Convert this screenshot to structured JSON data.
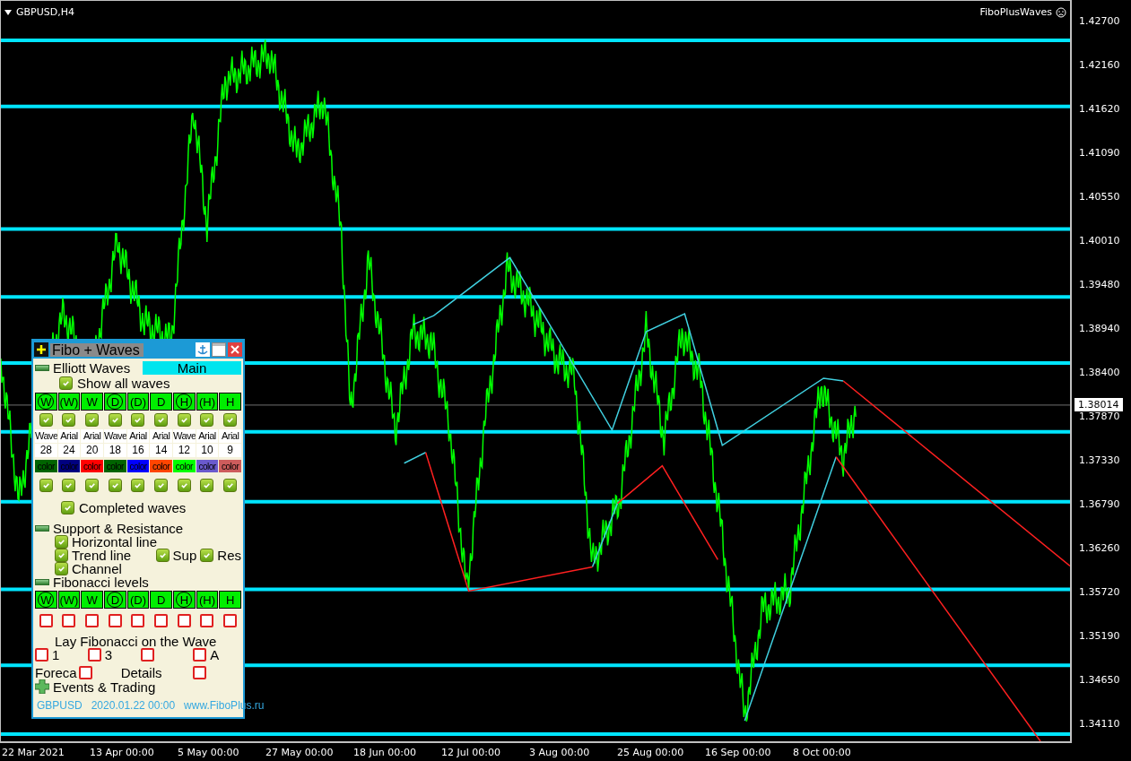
{
  "chart": {
    "symbol": "GBPUSD,H4",
    "indicator": "FiboPlusWaves",
    "price_labels": [
      "1.42700",
      "1.42160",
      "1.41620",
      "1.41090",
      "1.40550",
      "1.40010",
      "1.39480",
      "1.38940",
      "1.38400",
      "1.37870",
      "1.37330",
      "1.36790",
      "1.36260",
      "1.35720",
      "1.35190",
      "1.34650",
      "1.34110"
    ],
    "current_price": "1.38014",
    "time_labels": [
      "22 Mar 2021",
      "13 Apr 00:00",
      "5 May 00:00",
      "27 May 00:00",
      "18 Jun 00:00",
      "12 Jul 00:00",
      "3 Aug 00:00",
      "25 Aug 00:00",
      "16 Sep 00:00",
      "8 Oct 00:00"
    ]
  },
  "panel": {
    "title": "Fibo + Waves",
    "elliott": {
      "label": "Elliott Waves",
      "expanded": true,
      "main_button": "Main",
      "show_all": {
        "label": "Show all waves",
        "checked": true
      },
      "waves": [
        {
          "label": "W",
          "circled": true,
          "checked": true,
          "font": "Wave",
          "size": "28",
          "color": "#006400",
          "shown": true
        },
        {
          "label": "(W)",
          "circled": false,
          "checked": true,
          "font": "Arial",
          "size": "24",
          "color": "#000080",
          "shown": true
        },
        {
          "label": "W",
          "circled": false,
          "checked": true,
          "font": "Arial",
          "size": "20",
          "color": "#ff0000",
          "shown": true
        },
        {
          "label": "D",
          "circled": true,
          "checked": true,
          "font": "Wave",
          "size": "18",
          "color": "#006400",
          "shown": true
        },
        {
          "label": "(D)",
          "circled": false,
          "checked": true,
          "font": "Arial",
          "size": "16",
          "color": "#0000ff",
          "shown": true
        },
        {
          "label": "D",
          "circled": false,
          "checked": true,
          "font": "Arial",
          "size": "14",
          "color": "#ff4500",
          "shown": true
        },
        {
          "label": "H",
          "circled": true,
          "checked": true,
          "font": "Wave",
          "size": "12",
          "color": "#00ff00",
          "shown": true
        },
        {
          "label": "(H)",
          "circled": false,
          "checked": true,
          "font": "Arial",
          "size": "10",
          "color": "#6a5acd",
          "shown": true
        },
        {
          "label": "H",
          "circled": false,
          "checked": true,
          "font": "Arial",
          "size": "9",
          "color": "#cd5c5c",
          "shown": true
        }
      ],
      "color_labels": [
        "color",
        "color",
        "color",
        "color",
        "color",
        "color",
        "color",
        "color",
        "color"
      ],
      "completed": {
        "label": "Completed waves",
        "checked": true
      }
    },
    "support": {
      "label": "Support & Resistance",
      "expanded": true,
      "horizontal": {
        "label": "Horizontal line",
        "checked": true
      },
      "trend": {
        "label": "Trend line",
        "checked": true
      },
      "sup": {
        "label": "Sup",
        "checked": true
      },
      "res": {
        "label": "Res",
        "checked": true
      },
      "channel": {
        "label": "Channel",
        "checked": true
      }
    },
    "fibo": {
      "label": "Fibonacci levels",
      "expanded": true,
      "levels": [
        {
          "label": "W",
          "circled": true,
          "checked": false
        },
        {
          "label": "(W)",
          "circled": false,
          "checked": false
        },
        {
          "label": "W",
          "circled": false,
          "checked": false
        },
        {
          "label": "D",
          "circled": true,
          "checked": false
        },
        {
          "label": "(D)",
          "circled": false,
          "checked": false
        },
        {
          "label": "D",
          "circled": false,
          "checked": false
        },
        {
          "label": "H",
          "circled": true,
          "checked": false
        },
        {
          "label": "(H)",
          "circled": false,
          "checked": false
        },
        {
          "label": "H",
          "circled": false,
          "checked": false
        }
      ],
      "lay_label": "Lay Fibonacci on the Wave",
      "lay_options": [
        {
          "label": "1",
          "checked": false
        },
        {
          "label": "3",
          "checked": false
        },
        {
          "checked": false
        },
        {
          "label": "A",
          "checked": false
        }
      ],
      "forecast": {
        "label": "Foreca",
        "checked": false
      },
      "details": {
        "label": "Details",
        "checked": false
      }
    },
    "events": {
      "label": "Events & Trading",
      "expanded": false
    },
    "footer": {
      "symbol": "GBPUSD",
      "date": "2020.01.22 00:00",
      "site": "www.FiboPlus.ru"
    }
  }
}
